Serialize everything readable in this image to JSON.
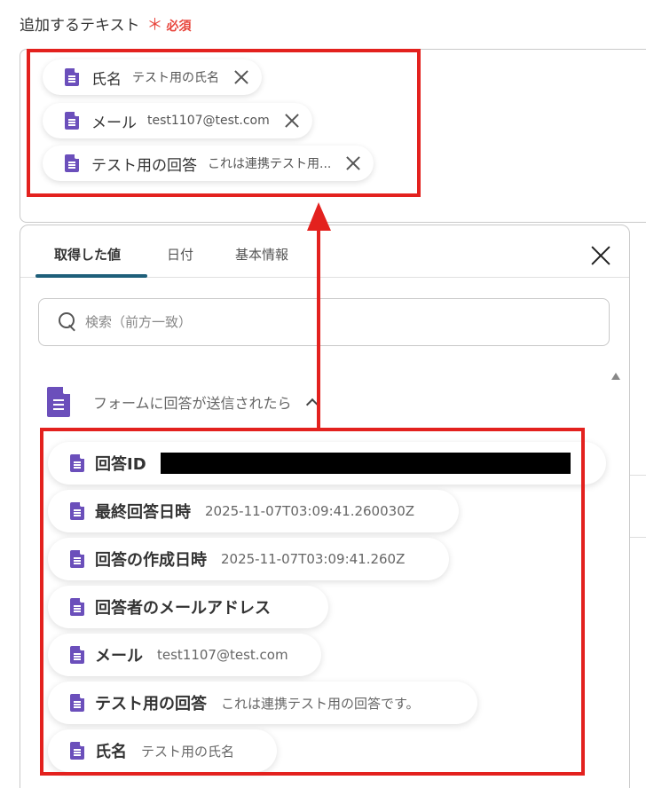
{
  "field": {
    "label": "追加するテキスト",
    "required_mark": "＊",
    "required_text": "必須"
  },
  "chips": [
    {
      "label": "氏名",
      "value": "テスト用の氏名"
    },
    {
      "label": "メール",
      "value": "test1107@test.com"
    },
    {
      "label": "テスト用の回答",
      "value": "これは連携テスト用..."
    }
  ],
  "panel": {
    "tabs": [
      "取得した値",
      "日付",
      "基本情報"
    ],
    "active_tab": 0,
    "search_placeholder": "検索（前方一致）",
    "section_title": "フォームに回答が送信されたら",
    "items": [
      {
        "label": "回答ID",
        "value": ""
      },
      {
        "label": "最終回答日時",
        "value": "2025-11-07T03:09:41.260030Z"
      },
      {
        "label": "回答の作成日時",
        "value": "2025-11-07T03:09:41.260Z"
      },
      {
        "label": "回答者のメールアドレス",
        "value": ""
      },
      {
        "label": "メール",
        "value": "test1107@test.com"
      },
      {
        "label": "テスト用の回答",
        "value": "これは連携テスト用の回答です。"
      },
      {
        "label": "氏名",
        "value": "テスト用の氏名"
      }
    ]
  },
  "colors": {
    "accent": "#1e5f7a",
    "highlight": "#e3211e",
    "icon": "#6b4fbb",
    "required": "#e8453c"
  },
  "icons": {
    "chip_icon": "document-icon",
    "remove_icon": "close-icon",
    "search_icon": "search-icon",
    "collapse_icon": "chevron-up-icon"
  }
}
